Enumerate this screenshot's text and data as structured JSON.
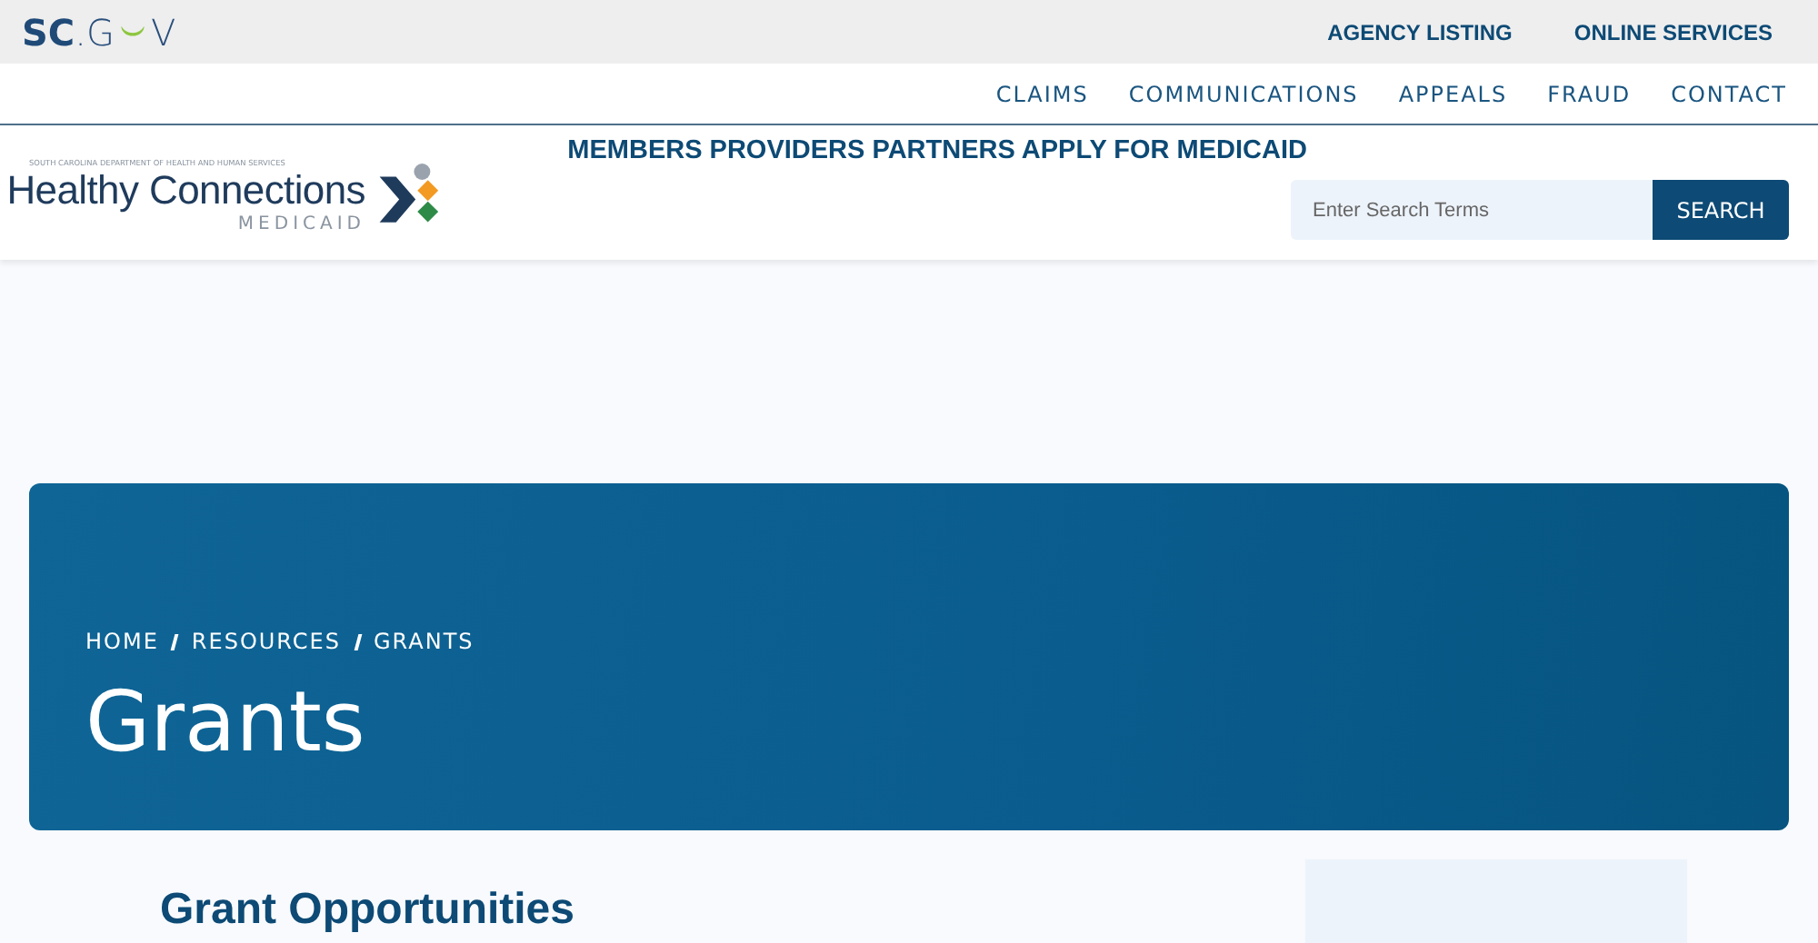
{
  "brand": {
    "parts": [
      "SC",
      ".G",
      "V"
    ]
  },
  "top_links": [
    "AGENCY LISTING",
    "ONLINE SERVICES"
  ],
  "nav": [
    "CLAIMS",
    "COMMUNICATIONS",
    "APPEALS",
    "FRAUD",
    "CONTACT"
  ],
  "logo": {
    "agency": "SOUTH CAROLINA DEPARTMENT OF HEALTH AND HUMAN SERVICES",
    "name": "Healthy Connections",
    "sub": "MEDICAID"
  },
  "main_menu": "MEMBERS PROVIDERS PARTNERS APPLY FOR MEDICAID",
  "search": {
    "placeholder": "Enter Search Terms",
    "button": "SEARCH"
  },
  "breadcrumb": [
    "HOME",
    "RESOURCES",
    "GRANTS"
  ],
  "page_title": "Grants",
  "section_heading": "Grant Opportunities"
}
